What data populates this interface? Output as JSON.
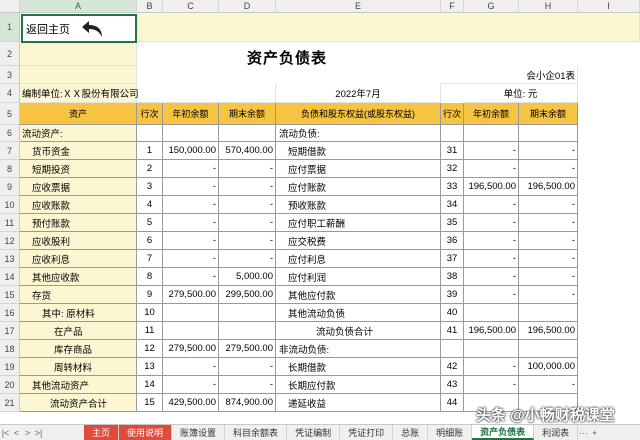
{
  "columns": [
    "A",
    "B",
    "C",
    "D",
    "E",
    "F",
    "G",
    "H",
    "I"
  ],
  "rows": [
    "1",
    "2",
    "3",
    "4",
    "5",
    "6",
    "7",
    "8",
    "9",
    "10",
    "11",
    "12",
    "13",
    "14",
    "15",
    "16",
    "17",
    "18",
    "19",
    "20",
    "21"
  ],
  "back_button": {
    "label": "返回主页"
  },
  "title": "资产负债表",
  "form_code": "会小企01表",
  "company": "编制单位:ＸＸ股份有限公司",
  "period": "2022年7月",
  "unit": "单位:  元",
  "headers": {
    "asset": "资产",
    "line1": "行次",
    "begin1": "年初余额",
    "end1": "期末余额",
    "liab": "负债和股东权益(或股东权益)",
    "line2": "行次",
    "begin2": "年初余额",
    "end2": "期末余额"
  },
  "table": [
    [
      "流动资产:",
      "",
      "",
      "",
      "流动负债:",
      "",
      "",
      ""
    ],
    [
      "货币资金",
      "1",
      "150,000.00",
      "570,400.00",
      "短期借款",
      "31",
      "-",
      "-"
    ],
    [
      "短期投资",
      "2",
      "-",
      "-",
      "应付票据",
      "32",
      "-",
      "-"
    ],
    [
      "应收票据",
      "3",
      "-",
      "-",
      "应付账款",
      "33",
      "196,500.00",
      "196,500.00"
    ],
    [
      "应收账款",
      "4",
      "-",
      "-",
      "预收账款",
      "34",
      "-",
      "-"
    ],
    [
      "预付账款",
      "5",
      "-",
      "-",
      "应付职工薪酬",
      "35",
      "-",
      "-"
    ],
    [
      "应收股利",
      "6",
      "-",
      "-",
      "应交税费",
      "36",
      "-",
      "-"
    ],
    [
      "应收利息",
      "7",
      "-",
      "-",
      "应付利息",
      "37",
      "-",
      "-"
    ],
    [
      "其他应收款",
      "8",
      "-",
      "5,000.00",
      "应付利润",
      "38",
      "-",
      "-"
    ],
    [
      "存货",
      "9",
      "279,500.00",
      "299,500.00",
      "其他应付款",
      "39",
      "-",
      "-"
    ],
    [
      "其中:  原材料",
      "10",
      "",
      "",
      "其他流动负债",
      "40",
      "",
      ""
    ],
    [
      "在产品",
      "11",
      "",
      "",
      "流动负债合计",
      "41",
      "196,500.00",
      "196,500.00"
    ],
    [
      "库存商品",
      "12",
      "279,500.00",
      "279,500.00",
      "非流动负债:",
      "",
      "",
      ""
    ],
    [
      "周转材料",
      "13",
      "-",
      "-",
      "长期借款",
      "42",
      "-",
      "100,000.00"
    ],
    [
      "其他流动资产",
      "14",
      "-",
      "-",
      "长期应付款",
      "43",
      "-",
      "-"
    ],
    [
      "流动资产合计",
      "15",
      "429,500.00",
      "874,900.00",
      "递延收益",
      "44",
      "",
      ""
    ]
  ],
  "sheet_tabs": [
    "主页",
    "使用说明",
    "账簿设置",
    "科目余额表",
    "凭证编制",
    "凭证打印",
    "总账",
    "明细账",
    "资产负债表",
    "利润表"
  ],
  "active_tab": "资产负债表",
  "nav": [
    "|<",
    "<",
    ">",
    ">|"
  ],
  "more": "···",
  "add": "+",
  "watermark": "头条 @小畅财税课堂"
}
